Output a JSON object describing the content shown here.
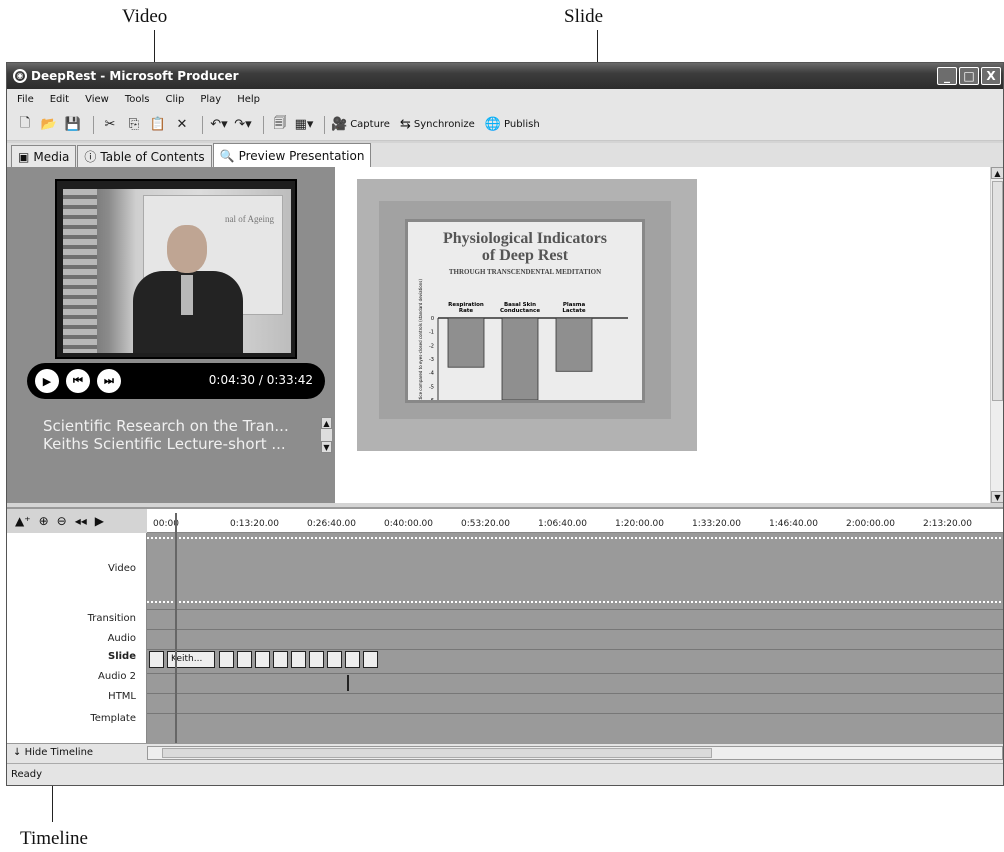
{
  "annotations": {
    "video": "Video",
    "slide": "Slide",
    "timeline": "Timeline"
  },
  "window": {
    "title": "DeepRest - Microsoft Producer",
    "controls": [
      "_",
      "□",
      "X"
    ]
  },
  "menu": [
    "File",
    "Edit",
    "View",
    "Tools",
    "Clip",
    "Play",
    "Help"
  ],
  "toolbar": {
    "capture": "Capture",
    "synchronize": "Synchronize",
    "publish": "Publish"
  },
  "tabs": [
    {
      "label": "Media",
      "icon": "media-icon"
    },
    {
      "label": "Table of Contents",
      "icon": "info-icon"
    },
    {
      "label": "Preview Presentation",
      "icon": "preview-icon",
      "active": true
    }
  ],
  "player": {
    "timecode": "0:04:30 / 0:33:42",
    "playlist": [
      "Scientific Research on the Tran...",
      "Keiths Scientific Lecture-short ..."
    ],
    "video_poster_text": "nal of Ageing"
  },
  "slide": {
    "title_line1": "Physiological Indicators",
    "title_line2": "of Deep Rest",
    "subtitle": "THROUGH TRANSCENDENTAL MEDITATION",
    "ylabel": "Change during practice compared to eyes-closed controls (standard deviations)",
    "chart_data": {
      "type": "bar",
      "categories": [
        "Respiration Rate",
        "Basal Skin Conductance",
        "Plasma Lactate"
      ],
      "values": [
        -3.6,
        -6.0,
        -3.9
      ],
      "ylim": [
        -6,
        0
      ],
      "yticks": [
        "0",
        "-1",
        "-2",
        "-3",
        "-4",
        "-5",
        "-6"
      ]
    }
  },
  "timeline": {
    "ticks": [
      "00:00",
      "0:13:20.00",
      "0:26:40.00",
      "0:40:00.00",
      "0:53:20.00",
      "1:06:40.00",
      "1:20:00.00",
      "1:33:20.00",
      "1:46:40.00",
      "2:00:00.00",
      "2:13:20.00"
    ],
    "tracks": [
      "Video",
      "Transition",
      "Audio",
      "Slide",
      "Audio 2",
      "HTML",
      "Template"
    ],
    "slide_clip_label": "Keith...",
    "slide_count": 11,
    "hide_label": "Hide Timeline"
  },
  "status": "Ready"
}
